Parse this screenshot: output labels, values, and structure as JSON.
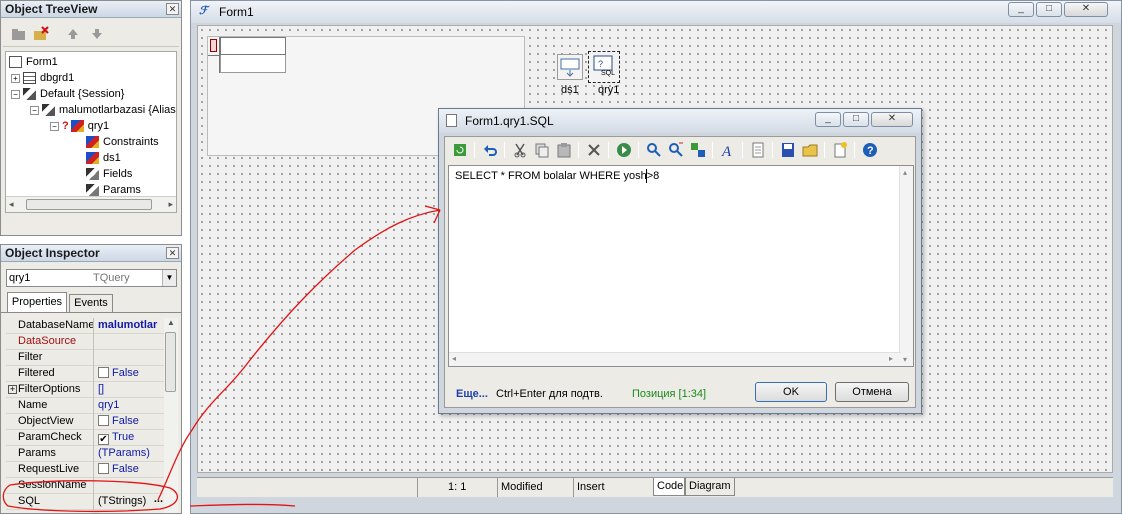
{
  "treeview": {
    "title": "Object TreeView",
    "nodes": [
      "Form1",
      "dbgrd1",
      "Default {Session}",
      "malumotlarbazasi {Alias",
      "qry1",
      "Constraints",
      "ds1",
      "Fields",
      "Params"
    ]
  },
  "inspector": {
    "title": "Object Inspector",
    "selector_name": "qry1",
    "selector_type": "TQuery",
    "tab_properties": "Properties",
    "tab_events": "Events",
    "rows": [
      {
        "name": "DatabaseName",
        "value": "malumotlar"
      },
      {
        "name": "DataSource",
        "value": ""
      },
      {
        "name": "Filter",
        "value": ""
      },
      {
        "name": "Filtered",
        "value": "False"
      },
      {
        "name": "FilterOptions",
        "value": "[]"
      },
      {
        "name": "Name",
        "value": "qry1"
      },
      {
        "name": "ObjectView",
        "value": "False"
      },
      {
        "name": "ParamCheck",
        "value": "True"
      },
      {
        "name": "Params",
        "value": "(TParams)"
      },
      {
        "name": "RequestLive",
        "value": "False"
      },
      {
        "name": "SessionName",
        "value": ""
      },
      {
        "name": "SQL",
        "value": "(TStrings)",
        "ellipsis": "..."
      }
    ]
  },
  "form": {
    "title": "Form1",
    "components": [
      {
        "label": "ds1"
      },
      {
        "label": "qry1",
        "icon_text": "SQL"
      }
    ]
  },
  "statusbar": {
    "position": "1:   1",
    "modified": "Modified",
    "mode": "Insert",
    "tab_code": "Code",
    "tab_diagram": "Diagram"
  },
  "sql_dialog": {
    "title": "Form1.qry1.SQL",
    "sql_text": "SELECT * FROM bolalar WHERE yosh>8",
    "more_link": "Еще...",
    "hint": "Ctrl+Enter для подтв.",
    "position_label": "Позиция [1:34]",
    "ok_label": "OK",
    "cancel_label": "Отмена"
  },
  "colors": {
    "panel_bg": "#ecebe6",
    "annotation_red": "#e01515",
    "value_blue": "#0f1aa6",
    "event_red": "#a01010",
    "position_green": "#1a8a1a"
  }
}
